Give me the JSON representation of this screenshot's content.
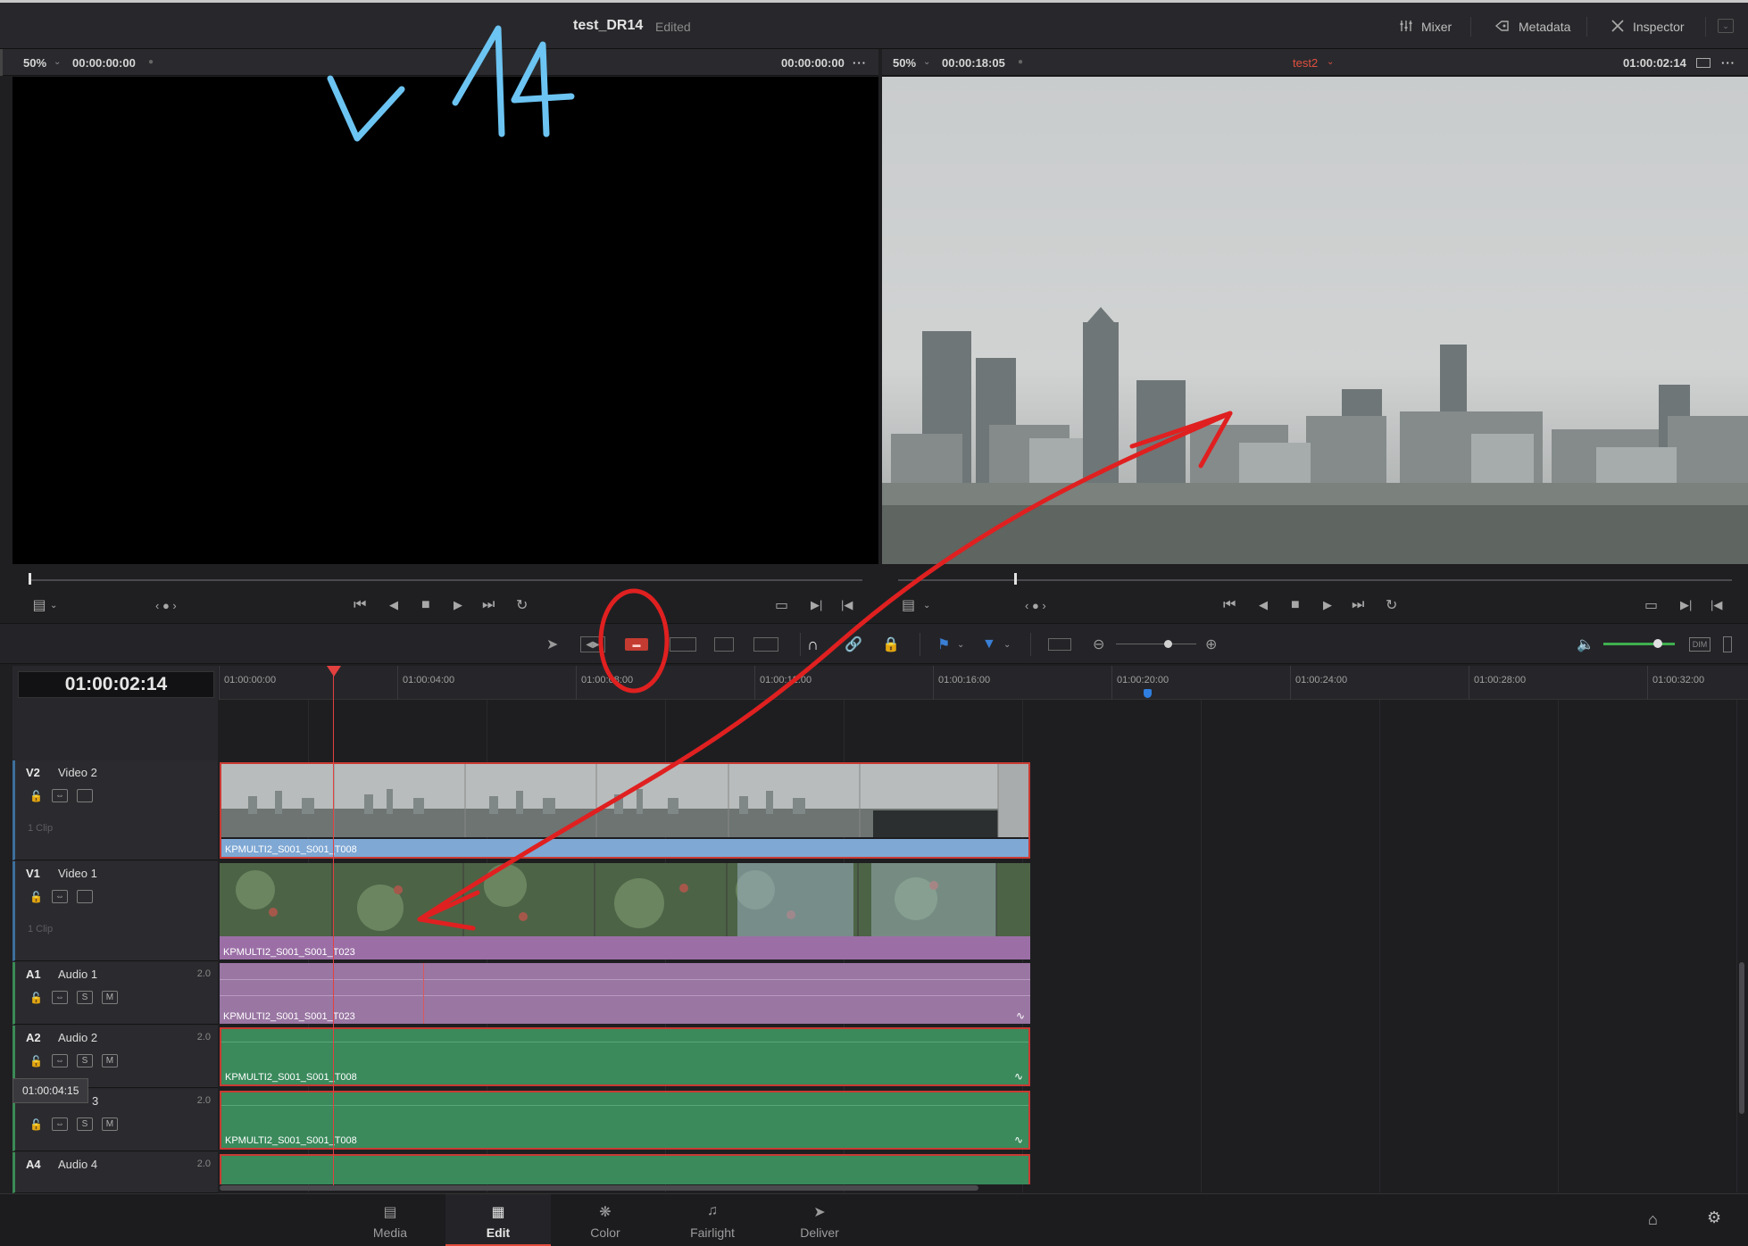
{
  "app": {
    "project_title": "test_DR14",
    "status": "Edited"
  },
  "top_buttons": [
    {
      "label": "Mixer",
      "icon": "mixer-icon"
    },
    {
      "label": "Metadata",
      "icon": "metadata-icon"
    },
    {
      "label": "Inspector",
      "icon": "inspector-icon"
    }
  ],
  "source_viewer": {
    "zoom": "50%",
    "timecode_left": "00:00:00:00",
    "timecode_right": "00:00:00:00"
  },
  "timeline_viewer": {
    "zoom": "50%",
    "duration": "00:00:18:05",
    "timeline_name": "test2",
    "timecode": "01:00:02:14"
  },
  "timeline": {
    "current_timecode": "01:00:02:14",
    "ruler_ticks": [
      "01:00:00:00",
      "01:00:04:00",
      "01:00:08:00",
      "01:00:12:00",
      "01:00:16:00",
      "01:00:20:00",
      "01:00:24:00",
      "01:00:28:00",
      "01:00:32:00"
    ],
    "tracks": [
      {
        "id": "V2",
        "name": "Video 2",
        "clip_count": "1 Clip",
        "clip_name": "KPMULTI2_S001_S001_T008"
      },
      {
        "id": "V1",
        "name": "Video 1",
        "clip_count": "1 Clip",
        "clip_name": "KPMULTI2_S001_S001_T023"
      },
      {
        "id": "A1",
        "name": "Audio 1",
        "channels": "2.0",
        "clip_name": "KPMULTI2_S001_S001_T023"
      },
      {
        "id": "A2",
        "name": "Audio 2",
        "channels": "2.0",
        "clip_name": "KPMULTI2_S001_S001_T008"
      },
      {
        "id": "A3",
        "name": "3",
        "channels": "2.0",
        "clip_name": "KPMULTI2_S001_S001_T008"
      },
      {
        "id": "A4",
        "name": "Audio 4",
        "channels": "2.0"
      }
    ],
    "solo_label": "S",
    "mute_label": "M",
    "tooltip": "01:00:04:15",
    "dim_label": "DIM"
  },
  "annotation": {
    "handwritten_text": "v 14"
  },
  "pages": [
    {
      "label": "Media",
      "icon": "media-icon"
    },
    {
      "label": "Edit",
      "icon": "edit-icon",
      "active": true
    },
    {
      "label": "Color",
      "icon": "color-icon"
    },
    {
      "label": "Fairlight",
      "icon": "fairlight-icon"
    },
    {
      "label": "Deliver",
      "icon": "deliver-icon"
    }
  ],
  "colors": {
    "accent_red": "#e14a3b",
    "video2_clip": "#7fa8d4",
    "video1_clip": "#9b6fa6",
    "audio1_clip": "#9a76a3",
    "audio_clip_green": "#3a8a5c",
    "annotation_red": "#e02020",
    "annotation_blue": "#6cc4f2"
  }
}
